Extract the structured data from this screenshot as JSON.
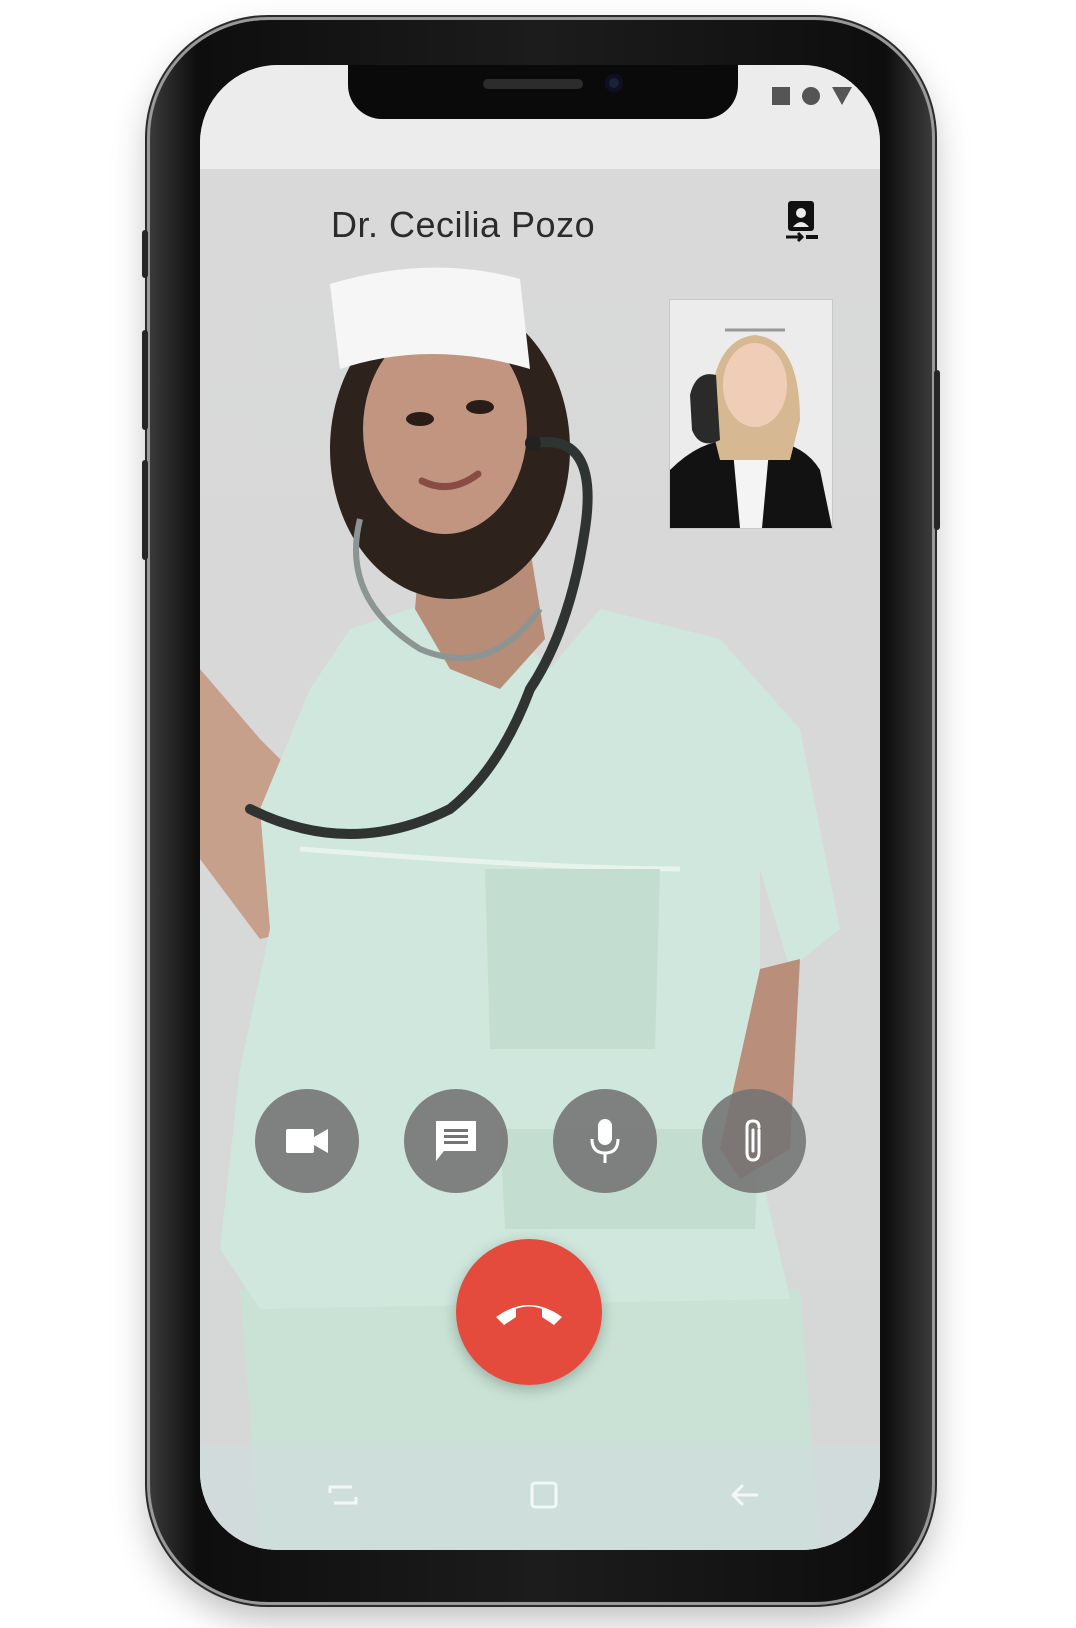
{
  "call": {
    "caller_name": "Dr. Cecilia Pozo"
  },
  "status_bar": {
    "icons": [
      "square-icon",
      "circle-icon",
      "triangle-down-icon"
    ]
  },
  "controls": [
    {
      "name": "video-camera-button",
      "icon": "video-camera-icon"
    },
    {
      "name": "chat-button",
      "icon": "chat-bubble-icon"
    },
    {
      "name": "microphone-button",
      "icon": "microphone-icon"
    },
    {
      "name": "attachment-button",
      "icon": "paperclip-icon"
    }
  ],
  "end_call": {
    "icon": "phone-hangup-icon",
    "color": "#e54b3c"
  },
  "nav_bar": {
    "icons": [
      "recent-apps-icon",
      "home-icon",
      "back-icon"
    ]
  },
  "colors": {
    "end_call": "#e54b3c",
    "control_bg": "#737373",
    "caller_name": "#2b2b2b"
  }
}
